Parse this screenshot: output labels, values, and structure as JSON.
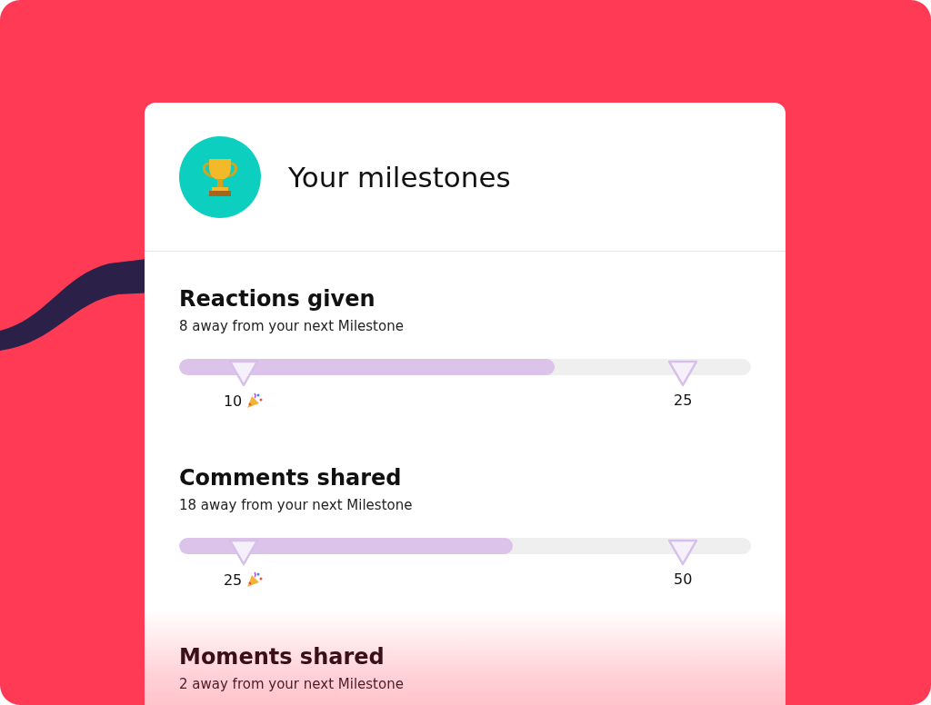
{
  "card": {
    "title": "Your milestones"
  },
  "stats": [
    {
      "name": "Reactions given",
      "subtitle": "8 away from your next Milestone",
      "level": 0.657,
      "milestones": [
        {
          "label": "10",
          "reached": true
        },
        {
          "label": "25",
          "reached": false
        }
      ]
    },
    {
      "name": "Comments shared",
      "subtitle": "18 away from your next Milestone",
      "level": 0.583,
      "milestones": [
        {
          "label": "25",
          "reached": true
        },
        {
          "label": "50",
          "reached": false
        }
      ]
    },
    {
      "name": "Moments shared",
      "subtitle": "2 away from your next Milestone"
    }
  ]
}
